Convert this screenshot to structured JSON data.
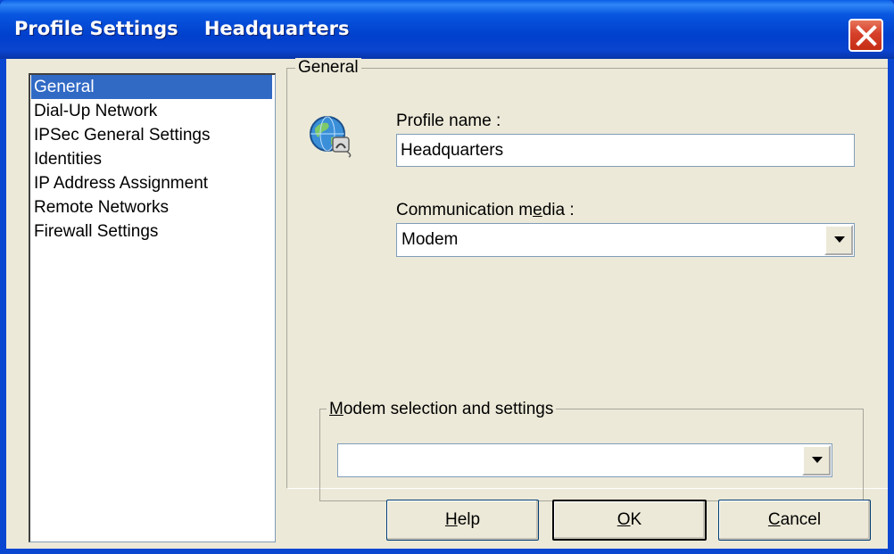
{
  "window": {
    "title": "Profile Settings    Headquarters"
  },
  "nav": {
    "items": [
      {
        "label": "General",
        "selected": true
      },
      {
        "label": "Dial-Up Network",
        "selected": false
      },
      {
        "label": "IPSec General Settings",
        "selected": false
      },
      {
        "label": "Identities",
        "selected": false
      },
      {
        "label": "IP Address Assignment",
        "selected": false
      },
      {
        "label": "Remote Networks",
        "selected": false
      },
      {
        "label": "Firewall Settings",
        "selected": false
      }
    ]
  },
  "general": {
    "group_label": "General",
    "icon": "globe-network-icon",
    "profile_name_label": "Profile name :",
    "profile_name_value": "Headquarters",
    "comm_media_label_pre": "Communication m",
    "comm_media_label_u": "e",
    "comm_media_label_post": "dia :",
    "comm_media_value": "Modem"
  },
  "modem": {
    "group_label_u": "M",
    "group_label_rest": "odem selection and settings",
    "select_value": ""
  },
  "buttons": {
    "help_u": "H",
    "help_rest": "elp",
    "ok_u": "O",
    "ok_rest": "K",
    "cancel_u": "C",
    "cancel_rest": "ancel"
  },
  "colors": {
    "titlebar": "#0a47d1",
    "selection": "#316ac5",
    "dialog_bg": "#ece9d8",
    "close_button": "#d6402a"
  }
}
